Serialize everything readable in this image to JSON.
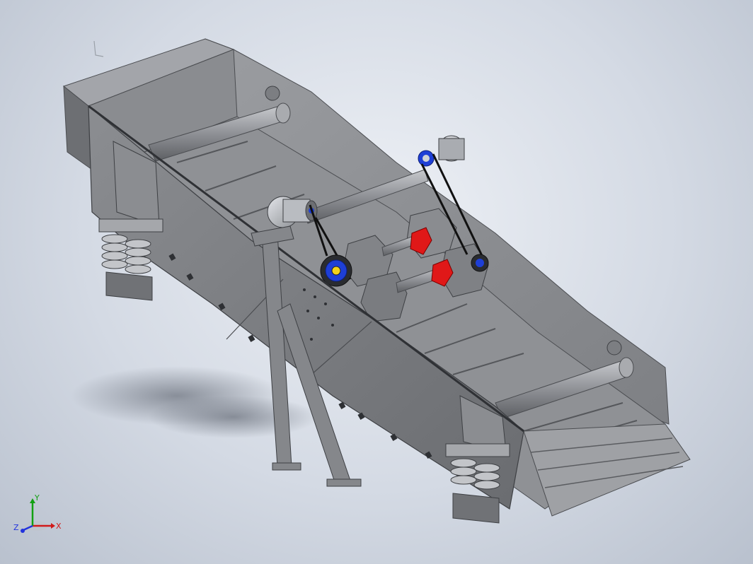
{
  "viewport": {
    "background_top": "#eef1f6",
    "background_bottom": "#b9c1ce"
  },
  "model": {
    "steel_color": "#7c7e82",
    "steel_dark": "#4b4d51",
    "steel_light": "#a3a5aa",
    "spring_color": "#9a9ca0",
    "motor_color": "#b9bcc1",
    "belt_color": "#111111",
    "pulley_accent": "#1e3fd6",
    "coupling_color": "#e01818",
    "shaft_color": "#9ea1a6"
  },
  "triad": {
    "x_label": "X",
    "y_label": "Y",
    "z_label": "Z",
    "x_color": "#d11a1a",
    "y_color": "#12a012",
    "z_color": "#2233dd"
  }
}
